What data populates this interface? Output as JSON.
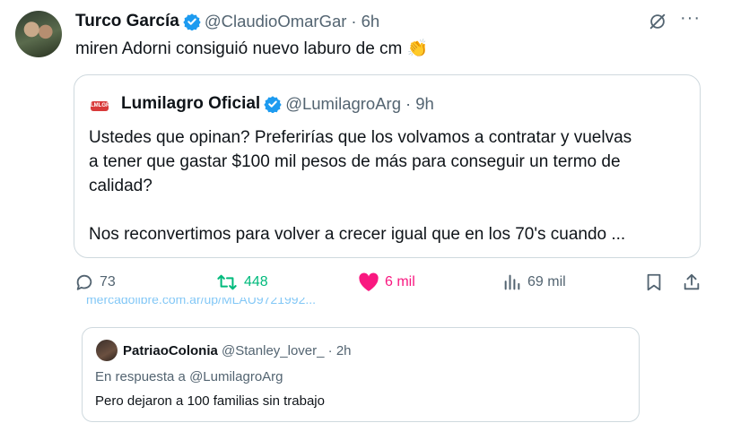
{
  "tweet": {
    "author_name": "Turco García",
    "handle": "@ClaudioOmarGar",
    "separator": "·",
    "time": "6h",
    "text": "miren Adorni consiguió nuevo laburo de cm",
    "emoji": "👏",
    "more_label": "···"
  },
  "quote": {
    "logo_text": "LMLGR",
    "author_name": "Lumilagro Oficial",
    "handle": "@LumilagroArg",
    "separator": "·",
    "time": "9h",
    "text": "Ustedes que opinan? Preferirías que los volvamos a contratar y vuelvas\na tener que gastar $100 mil pesos de más para conseguir un termo de\ncalidad?\n\nNos reconvertimos para volver a crecer igual que en los 70's cuando ..."
  },
  "actions": {
    "replies": "73",
    "reposts": "448",
    "likes": "6 mil",
    "views": "69 mil"
  },
  "colors": {
    "repost": "#00ba7c",
    "like": "#f91880",
    "verified": "#1d9bf0",
    "muted": "#536471"
  },
  "cut_link": "mercadolibre.com.ar/up/MLAU9721992...",
  "reply_card": {
    "author_name": "PatriaoColonia",
    "handle": "@Stanley_lover_",
    "separator": "·",
    "time": "2h",
    "in_reply_to": "En respuesta a @LumilagroArg",
    "text": "Pero dejaron a 100 familias sin trabajo"
  }
}
